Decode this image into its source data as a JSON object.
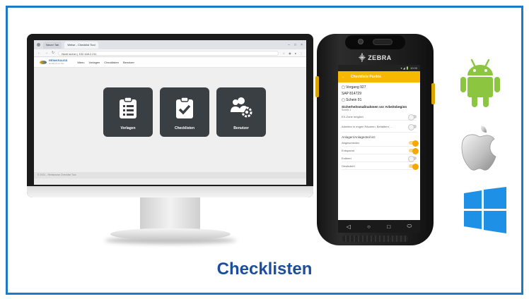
{
  "page": {
    "title": "Checklisten"
  },
  "browser": {
    "tabs": [
      "Neuer Tab",
      "Weise - Checklist Tool"
    ],
    "address": "Nicht sicher | 192.168.2.211"
  },
  "app": {
    "logo_name": "REINKRAUSS",
    "logo_sub": "GmbH & Co KG",
    "nav": [
      "Menu",
      "Vorlagen",
      "Checklisten",
      "Benutzer"
    ],
    "tiles": [
      {
        "label": "Vorlagen",
        "icon": "clipboard-list-icon"
      },
      {
        "label": "Checklisten",
        "icon": "clipboard-check-icon"
      },
      {
        "label": "Benutzer",
        "icon": "users-cog-icon"
      }
    ],
    "footer": "© 2021 - Reinkrauss Checklist Tool"
  },
  "phone": {
    "brand": "ZEBRA",
    "status": "▾ ◢ 🔋 10:00",
    "appbar_title": "Checkliste Punkte",
    "lines": [
      "Vorgang 927",
      "SAP 814729",
      "Schein 91"
    ],
    "section": "Sicherheitsmaßnahmen vor Arbeitsbeginn",
    "section_sub": "Schritt 1",
    "rows": [
      {
        "label": "EX-Zone möglich",
        "on": false
      },
      {
        "label": "Arbeiten in engen Räumen, Behältern, ...",
        "on": false
      }
    ],
    "section2": "Anlagen/Anlagenteil ist:",
    "rows2": [
      {
        "label": "Abgeschieden",
        "on": true
      },
      {
        "label": "Entspannt",
        "on": true
      },
      {
        "label": "Entleert",
        "on": false
      },
      {
        "label": "Gesäubert",
        "on": true
      }
    ]
  },
  "os_icons": [
    "android-icon",
    "apple-icon",
    "windows-icon"
  ],
  "colors": {
    "accent": "#1f79c9",
    "title": "#1d4e9c",
    "android": "#8cc540",
    "windows": "#1e90e6",
    "phone_bar": "#f6b800"
  }
}
